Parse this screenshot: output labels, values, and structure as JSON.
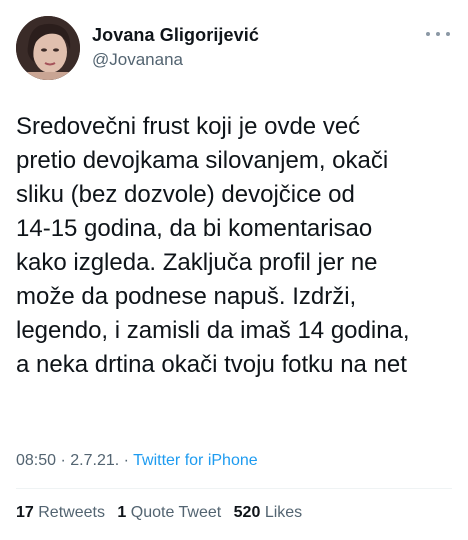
{
  "author": {
    "display_name": "Jovana Gligorijević",
    "handle": "@Jovanana",
    "avatar_icon": "profile-photo"
  },
  "menu_icon": "more-dots-icon",
  "tweet": {
    "lines": [
      "Sredovečni frust koji je ovde već",
      "pretio devojkama silovanjem, okači",
      "sliku (bez dozvole) devojčice od",
      "14-15 godina, da bi komentarisao",
      "kako izgleda. Zaključa profil jer ne",
      "može da podnese napuš. Izdrži,",
      "legendo, i zamisli da imaš 14 godina,",
      "a neka drtina okači tvoju fotku na net"
    ]
  },
  "meta": {
    "time": "08:50",
    "sep1": " · ",
    "date": "2.7.21.",
    "sep2": " · ",
    "source": "Twitter for iPhone"
  },
  "stats": {
    "retweets_count": "17",
    "retweets_label": "Retweets",
    "quotes_count": "1",
    "quotes_label": "Quote Tweet",
    "likes_count": "520",
    "likes_label": "Likes"
  },
  "colors": {
    "text": "#0f1419",
    "secondary": "#536471",
    "link": "#1d9bf0"
  }
}
